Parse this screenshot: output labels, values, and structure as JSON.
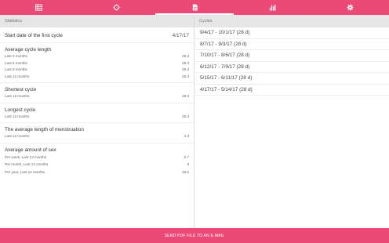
{
  "tabs": [
    {
      "icon": "list-icon",
      "active": false
    },
    {
      "icon": "cycle-icon",
      "active": false
    },
    {
      "icon": "document-icon",
      "active": true
    },
    {
      "icon": "bar-chart-icon",
      "active": false
    },
    {
      "icon": "gear-icon",
      "active": false
    }
  ],
  "colors": {
    "accent": "#ec4a76",
    "header_bg": "#e6e6e6"
  },
  "statistics": {
    "header": "Statistics",
    "start_label": "Start date of the first cycle",
    "start_value": "4/17/17",
    "avg_cycle": {
      "title": "Average cycle length",
      "rows": [
        {
          "label": "Last 3 months",
          "value": "28 d"
        },
        {
          "label": "Last 6 months",
          "value": "28 d"
        },
        {
          "label": "Last 9 months",
          "value": "28 d"
        },
        {
          "label": "Last 12 months",
          "value": "28 d"
        }
      ]
    },
    "shortest": {
      "title": "Shortest cycle",
      "rows": [
        {
          "label": "Last 12 months",
          "value": "28 d"
        }
      ]
    },
    "longest": {
      "title": "Longest cycle",
      "rows": [
        {
          "label": "Last 12 months",
          "value": "28 d"
        }
      ]
    },
    "menstruation": {
      "title": "The average length of menstruation",
      "rows": [
        {
          "label": "Last 12 months",
          "value": "4 d"
        }
      ]
    },
    "sex": {
      "title": "Average amount of sex",
      "rows": [
        {
          "label": "Per week, Last 12 months",
          "value": "0.7"
        },
        {
          "label": "Per month, Last 12 months",
          "value": "3"
        },
        {
          "label": "Per year, Last 12 months",
          "value": "36.5"
        }
      ]
    }
  },
  "cycles": {
    "header": "Cycles",
    "items": [
      "9/4/17 - 10/1/17 (28 d)",
      "8/7/17 - 9/3/17 (28 d)",
      "7/10/17 - 8/6/17 (28 d)",
      "6/12/17 - 7/9/17 (28 d)",
      "5/15/17 - 6/11/17 (28 d)",
      "4/17/17 - 5/14/17 (28 d)"
    ]
  },
  "bottom_button": "SEND PDF FILE TO AN E-MAIL"
}
